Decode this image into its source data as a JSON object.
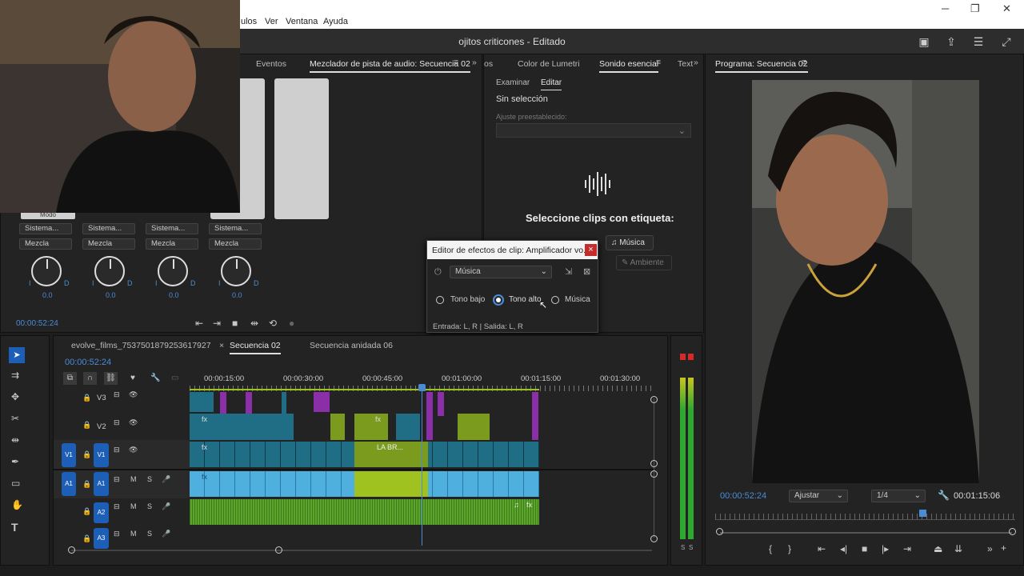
{
  "menubar": {
    "items": [
      "ulos",
      "Ver",
      "Ventana",
      "Ayuda"
    ],
    "win_min": "─",
    "win_max": "❐",
    "win_close": "✕"
  },
  "title": "ojitos criticones - Editado",
  "audio_panel": {
    "tab_events": "Eventos",
    "tab_mixer": "Mezclador de pista de audio: Secuencia 02",
    "mode": "Modo",
    "channels": [
      {
        "sys": "Sistema...",
        "mix": "Mezcla",
        "val": "0.0"
      },
      {
        "sys": "Sistema...",
        "mix": "Mezcla",
        "val": "0.0"
      },
      {
        "sys": "Sistema...",
        "mix": "Mezcla",
        "val": "0.0"
      },
      {
        "sys": "Sistema...",
        "mix": "Mezcla",
        "val": "0.0"
      }
    ],
    "left": "I",
    "right": "D",
    "timecode": "00:00:52:24"
  },
  "essential": {
    "tab_os": "os",
    "tab_lumetri": "Color de Lumetri",
    "tab_sound": "Sonido esencial",
    "tab_text": "Text",
    "sub_browse": "Examinar",
    "sub_edit": "Editar",
    "no_selection": "Sin selección",
    "preset_label": "Ajuste preestablecido:",
    "prompt": "Seleccione clips con etiqueta:",
    "btn_music": "Música",
    "btn_ambient": "Ambiente"
  },
  "dialog": {
    "title": "Editor de efectos de clip: Amplificador vo...",
    "close": "×",
    "preset": "Música",
    "opt_low": "Tono bajo",
    "opt_high": "Tono alto",
    "opt_music": "Música",
    "selected": "opt_high",
    "io": "Entrada: L, R | Salida: L, R"
  },
  "program": {
    "tab": "Programa: Secuencia 02",
    "timecode": "00:00:52:24",
    "fit": "Ajustar",
    "res": "1/4",
    "duration": "00:01:15:06"
  },
  "timeline": {
    "tabs": [
      {
        "label": "evolve_films_7537501879253617927"
      },
      {
        "label": "Secuencia 02"
      },
      {
        "label": "Secuencia anidada 06"
      }
    ],
    "close": "×",
    "timecode": "00:00:52:24",
    "ruler": [
      "00:00:15:00",
      "00:00:30:00",
      "00:00:45:00",
      "00:01:00:00",
      "00:01:15:00",
      "00:01:30:00"
    ],
    "tracks": [
      {
        "name": "V3",
        "src": ""
      },
      {
        "name": "V2",
        "src": ""
      },
      {
        "name": "V1",
        "src": "V1"
      },
      {
        "name": "A1",
        "src": "A1"
      },
      {
        "name": "A2",
        "src": ""
      },
      {
        "name": "A3",
        "src": ""
      }
    ],
    "mute": "M",
    "solo": "S",
    "clip_label": "LA BR...",
    "fx": "fx"
  },
  "meter": {
    "labels": [
      "S",
      "S"
    ]
  },
  "colors": {
    "accent": "#4a8bd6",
    "video_clip": "#1f6e86",
    "video_clip_alt": "#7b9b1f",
    "purple_clip": "#8b2fa8",
    "audio_clip": "#4fb0e0",
    "audio_green": "#5aa52a",
    "lime": "#9fc221"
  }
}
